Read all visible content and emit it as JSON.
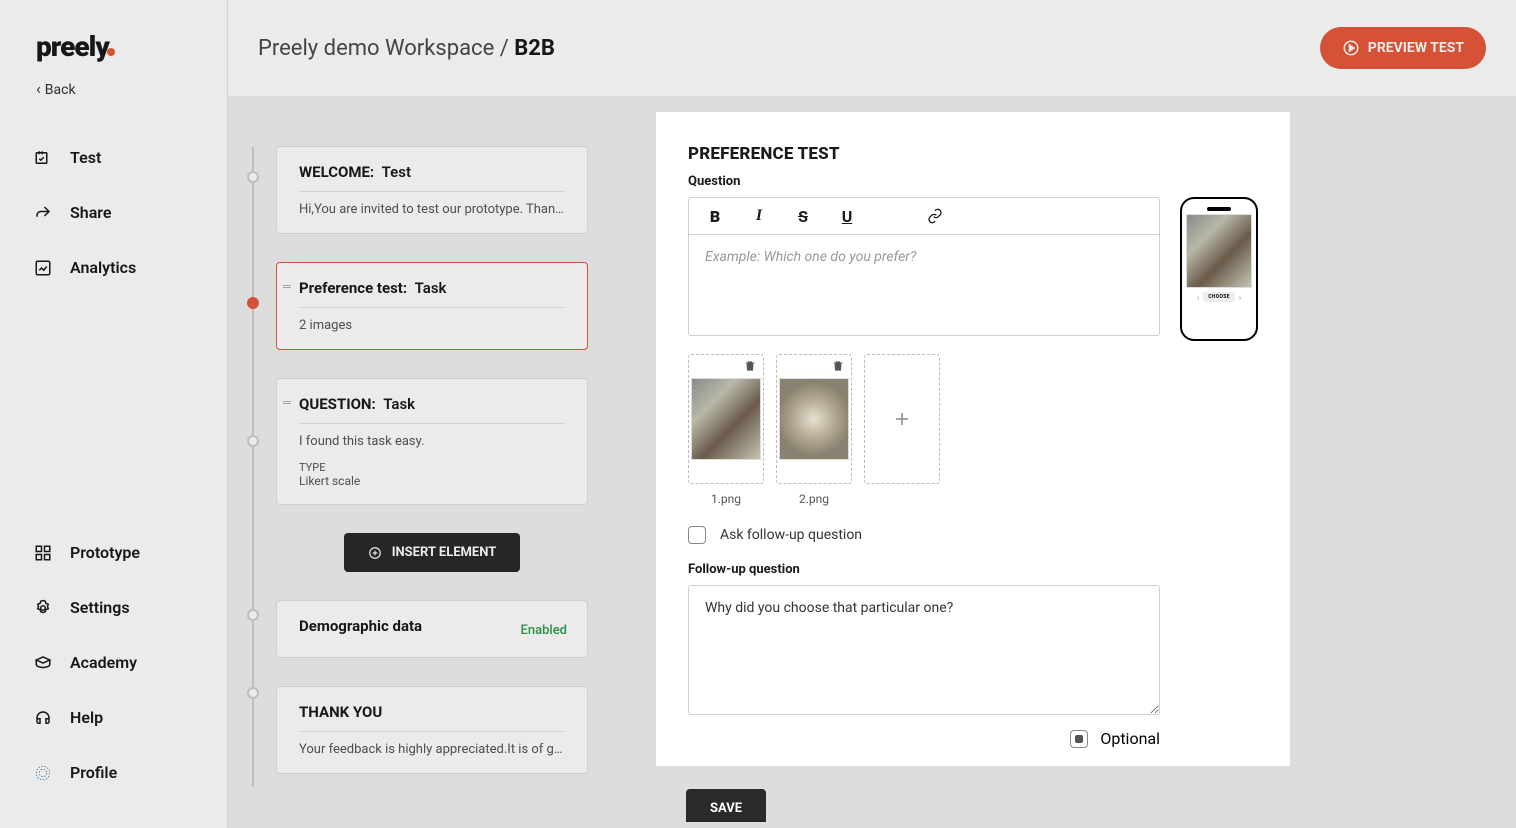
{
  "logo": "preely",
  "back_label": "Back",
  "nav_top": [
    {
      "label": "Test"
    },
    {
      "label": "Share"
    },
    {
      "label": "Analytics"
    }
  ],
  "nav_bottom": [
    {
      "label": "Prototype"
    },
    {
      "label": "Settings"
    },
    {
      "label": "Academy"
    },
    {
      "label": "Help"
    },
    {
      "label": "Profile"
    }
  ],
  "breadcrumb": {
    "workspace": "Preely demo Workspace",
    "sep": "/",
    "project": "B2B"
  },
  "preview_btn": "PREVIEW TEST",
  "cards": {
    "welcome": {
      "title_pre": "WELCOME:",
      "title": "Test",
      "body": "Hi,You are invited to test our prototype. Than…"
    },
    "pref": {
      "title_pre": "Preference test:",
      "title": "Task",
      "body": "2 images"
    },
    "question": {
      "title_pre": "QUESTION:",
      "title": "Task",
      "body": "I found this task easy.",
      "type_lbl": "TYPE",
      "type_val": "Likert scale"
    },
    "demo": {
      "title": "Demographic data",
      "badge": "Enabled"
    },
    "thank": {
      "title": "THANK YOU",
      "body": "Your feedback is highly appreciated.It is of g…"
    }
  },
  "insert_btn": "INSERT ELEMENT",
  "panel": {
    "heading": "PREFERENCE TEST",
    "question_label": "Question",
    "question_placeholder": "Example: Which one do you prefer?",
    "device_choose": "CHOOSE",
    "images": [
      "1.png",
      "2.png"
    ],
    "ask_followup": "Ask follow-up question",
    "followup_label": "Follow-up question",
    "followup_value": "Why did you choose that particular one?",
    "optional_label": "Optional",
    "save_label": "SAVE"
  }
}
